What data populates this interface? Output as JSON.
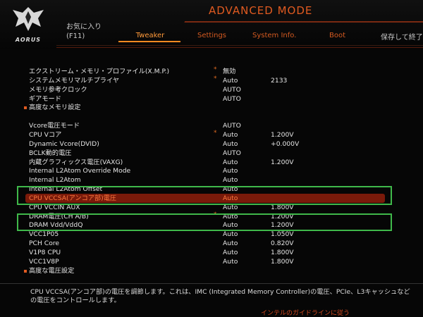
{
  "header": {
    "brand": "AORUS",
    "mode_title": "ADVANCED MODE",
    "favorites_label": "お気に入り",
    "favorites_key": "(F11)",
    "tabs": [
      {
        "label": "Tweaker",
        "active": true
      },
      {
        "label": "Settings",
        "active": false
      },
      {
        "label": "System Info.",
        "active": false
      },
      {
        "label": "Boot",
        "active": false
      },
      {
        "label": "保存して終了",
        "active": false
      }
    ]
  },
  "settings": [
    {
      "label": "エクストリーム・メモリ・プロファイル(X.M.P.)",
      "star": "*",
      "value": "無効",
      "value2": ""
    },
    {
      "label": "システムメモリマルチプライヤ",
      "star": "*",
      "value": "Auto",
      "value2": "2133"
    },
    {
      "label": "メモリ参考クロック",
      "star": "",
      "value": "AUTO",
      "value2": ""
    },
    {
      "label": "ギアモード",
      "star": "",
      "value": "AUTO",
      "value2": ""
    },
    {
      "label": "高度なメモリ設定",
      "star": "",
      "value": "",
      "value2": "",
      "submenu": true
    },
    {
      "label": "",
      "star": "",
      "value": "",
      "value2": ""
    },
    {
      "label": "Vcore電圧モード",
      "star": "",
      "value": "AUTO",
      "value2": ""
    },
    {
      "label": "CPU Vコア",
      "star": "*",
      "value": "Auto",
      "value2": "1.200V"
    },
    {
      "label": "Dynamic Vcore(DVID)",
      "star": "",
      "value": "Auto",
      "value2": "+0.000V"
    },
    {
      "label": "BCLK動的電圧",
      "star": "",
      "value": "AUTO",
      "value2": ""
    },
    {
      "label": "内蔵グラフィックス電圧(VAXG)",
      "star": "",
      "value": "Auto",
      "value2": "1.200V"
    },
    {
      "label": "Internal L2Atom Override Mode",
      "star": "",
      "value": "Auto",
      "value2": ""
    },
    {
      "label": "Internal L2Atom",
      "star": "",
      "value": "Auto",
      "value2": ""
    },
    {
      "label": "Internal L2Atom Offset",
      "star": "",
      "value": "Auto",
      "value2": ""
    },
    {
      "label": "CPU VCCSA(アンコア部)電圧",
      "star": "",
      "value": "Auto",
      "value2": "",
      "selected": true
    },
    {
      "label": "CPU VCCIN AUX",
      "star": "",
      "value": "Auto",
      "value2": "1.800V"
    },
    {
      "label": "DRAM電圧(CH A/B)",
      "star": "*",
      "value": "Auto",
      "value2": "1.200V"
    },
    {
      "label": "DRAM Vdd/VddQ",
      "star": "",
      "value": "Auto",
      "value2": "1.200V"
    },
    {
      "label": "VCC1P05",
      "star": "",
      "value": "Auto",
      "value2": "1.050V"
    },
    {
      "label": "PCH Core",
      "star": "",
      "value": "Auto",
      "value2": "0.820V"
    },
    {
      "label": "V1P8 CPU",
      "star": "",
      "value": "Auto",
      "value2": "1.800V"
    },
    {
      "label": "VCC1V8P",
      "star": "",
      "value": "Auto",
      "value2": "1.800V"
    },
    {
      "label": "高度な電圧設定",
      "star": "",
      "value": "",
      "value2": "",
      "submenu": true
    }
  ],
  "help": {
    "text": "CPU VCCSA(アンコア部)の電圧を調節します。これは、IMC (Integrated Memory Controller)の電圧、PCIe、L3キャッシュなどの電圧をコントロールします。",
    "highlight": "インテルのガイドラインに従う"
  },
  "colors": {
    "accent": "#e05a20",
    "selection": "#7a1a0a",
    "annotation_box": "#3fb84a"
  }
}
